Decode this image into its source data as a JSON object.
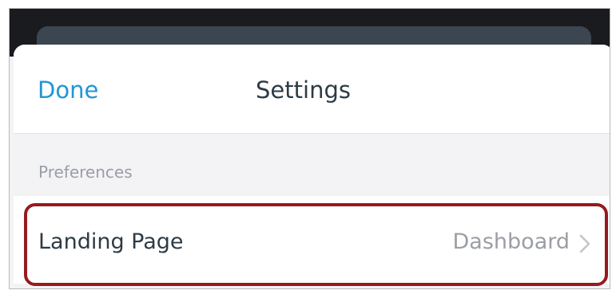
{
  "navbar": {
    "done_label": "Done",
    "title": "Settings"
  },
  "sections": [
    {
      "header": "Preferences",
      "rows": [
        {
          "label": "Landing Page",
          "value": "Dashboard",
          "icon": "chevron-right-icon"
        }
      ]
    }
  ],
  "colors": {
    "accent": "#2196d6",
    "highlight": "#951b1e",
    "text_primary": "#2d3b45",
    "text_secondary": "#9b9ea4"
  }
}
